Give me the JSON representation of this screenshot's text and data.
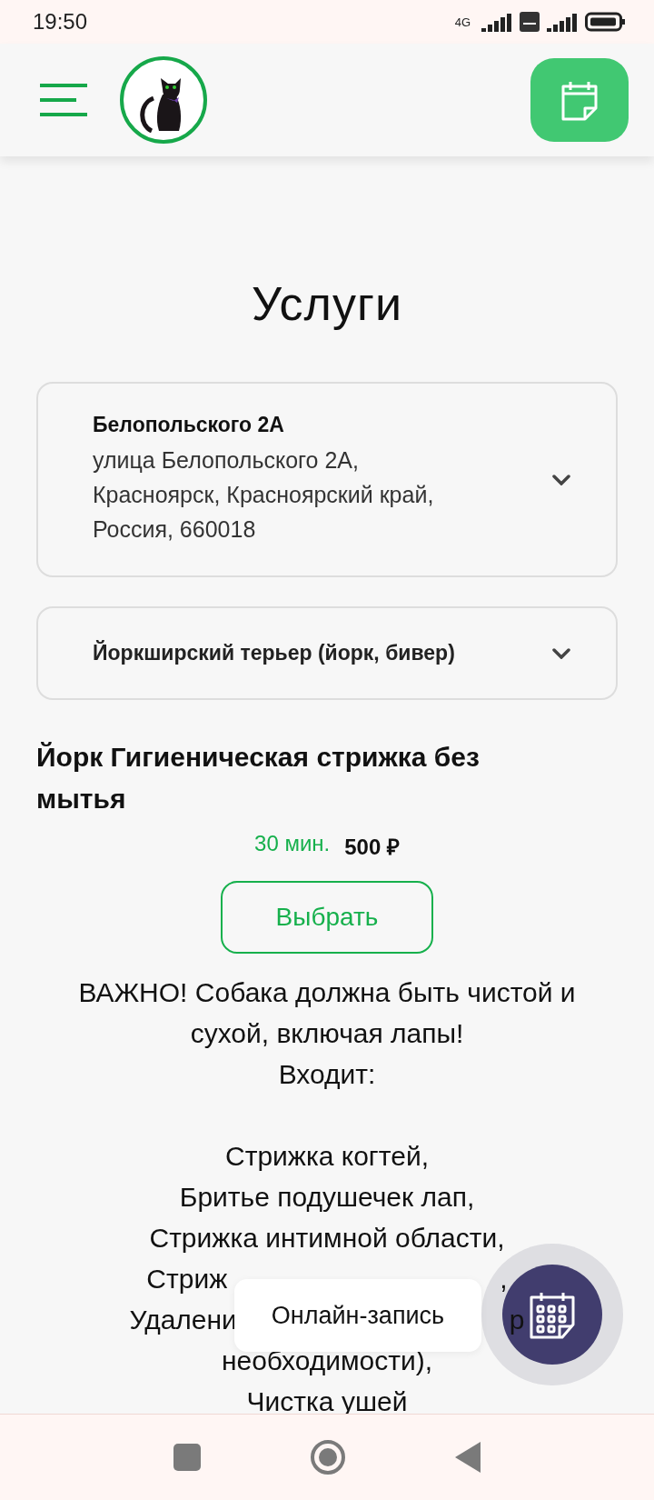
{
  "status_bar": {
    "time": "19:50",
    "network": "4G"
  },
  "page_title": "Услуги",
  "location_select": {
    "name": "Белопольского 2А",
    "address": "улица Белопольского 2А, Красноярск, Красноярский край, Россия, 660018"
  },
  "breed_select": {
    "value": "Йоркширский терьер (йорк, бивер)"
  },
  "service": {
    "title": "Йорк Гигиеническая стрижка без мытья",
    "duration": "30 мин.",
    "price": "500 ₽",
    "button": "Выбрать"
  },
  "description": [
    {
      "kind": "full",
      "text": "ВАЖНО! Собака должна быть чистой и"
    },
    {
      "kind": "full",
      "text": "сухой, включая лапы!"
    },
    {
      "kind": "full",
      "text": "Входит:"
    },
    {
      "kind": "blank"
    },
    {
      "kind": "full",
      "text": "Стрижка когтей,"
    },
    {
      "kind": "full",
      "text": "Бритье подушечек лап,"
    },
    {
      "kind": "full",
      "text": "Стрижка интимной области,"
    },
    {
      "kind": "covered",
      "left": "Стриж",
      "right": ","
    },
    {
      "kind": "covered",
      "left": "Удалени",
      "right": "р"
    },
    {
      "kind": "full",
      "text": "необходимости),"
    },
    {
      "kind": "full",
      "text": "Чистка ушей"
    }
  ],
  "online_booking": {
    "label": "Онлайн-запись"
  }
}
